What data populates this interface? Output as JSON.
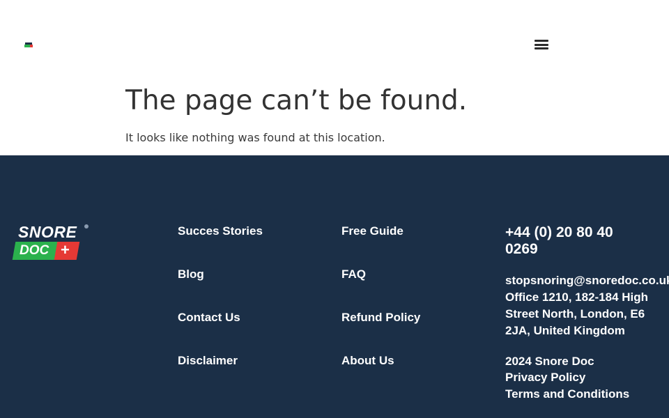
{
  "header": {
    "logo_alt": "Snore Doc",
    "menu_icon": "hamburger-menu-icon"
  },
  "main": {
    "title": "The page can’t be found.",
    "message": "It looks like nothing was found at this location."
  },
  "footer": {
    "brand": {
      "line1": "SNORE",
      "line2": "DOC",
      "plus": "+",
      "colors": {
        "background": "#1b2f47",
        "green": "#2bb14d",
        "red": "#e53935"
      }
    },
    "column1": [
      "Succes Stories",
      "Blog",
      "Contact Us",
      "Disclaimer"
    ],
    "column2": [
      "Free Guide",
      "FAQ",
      "Refund Policy",
      "About Us"
    ],
    "contact": {
      "phone": "+44 (0) 20 80 40 0269",
      "email": "stopsnoring@snoredoc.co.uk",
      "address": "Office 1210, 182-184 High Street North, London, E6 2JA, United Kingdom"
    },
    "copyright": "2024 Snore Doc",
    "legal": [
      "Privacy Policy",
      "Terms and Conditions"
    ]
  }
}
